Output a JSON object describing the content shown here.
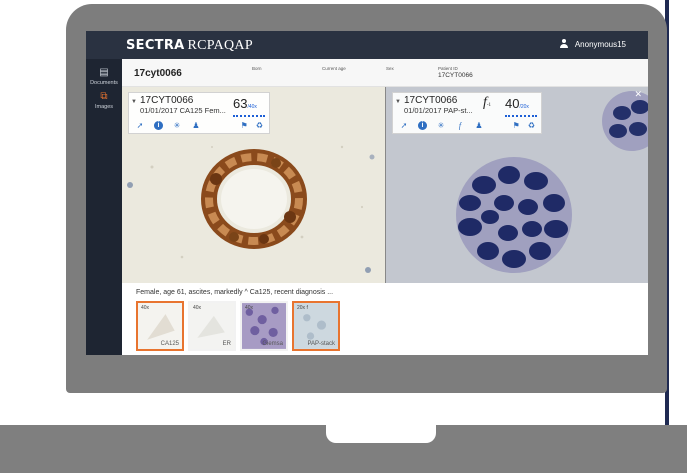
{
  "app": {
    "brand_bold": "SECTRA",
    "brand_rest": "RCPAQAP",
    "user": "Anonymous15"
  },
  "sidebar": {
    "items": [
      {
        "label": "Documents",
        "icon": "document-icon"
      },
      {
        "label": "Images",
        "icon": "images-icon",
        "active": true
      }
    ]
  },
  "header": {
    "case_id": "17cyt0066",
    "fields": [
      {
        "label": "Born",
        "value": ""
      },
      {
        "label": "Current age",
        "value": ""
      },
      {
        "label": "Sex",
        "value": ""
      },
      {
        "label": "Patient ID",
        "value": "17CYT0066"
      }
    ]
  },
  "viewers": {
    "left": {
      "id": "17CYT0066",
      "subtitle": "01/01/2017  CA125  Fem...",
      "magnification": "63",
      "mag_unit": "/40x"
    },
    "right": {
      "id": "17CYT0066",
      "subtitle": "01/01/2017  PAP-st...",
      "f_symbol": "f",
      "f_sub": "-1",
      "magnification": "40",
      "mag_unit": "/20x"
    }
  },
  "bottom": {
    "caption": "Female, age 61, ascites, markedly ^ Ca125, recent diagnosis ...",
    "thumbnails": [
      {
        "mag": "40x",
        "label": "CA125",
        "selected": true
      },
      {
        "mag": "40x",
        "label": "ER",
        "selected": false
      },
      {
        "mag": "40x",
        "label": "Giemsa",
        "selected": false
      },
      {
        "mag": "20x f",
        "label": "PAP-stack",
        "selected": true
      }
    ]
  },
  "colors": {
    "accent": "#e8742f",
    "topbar": "#2a3241",
    "sidebar": "#1e2532",
    "tool_blue": "#2f6fc2"
  }
}
